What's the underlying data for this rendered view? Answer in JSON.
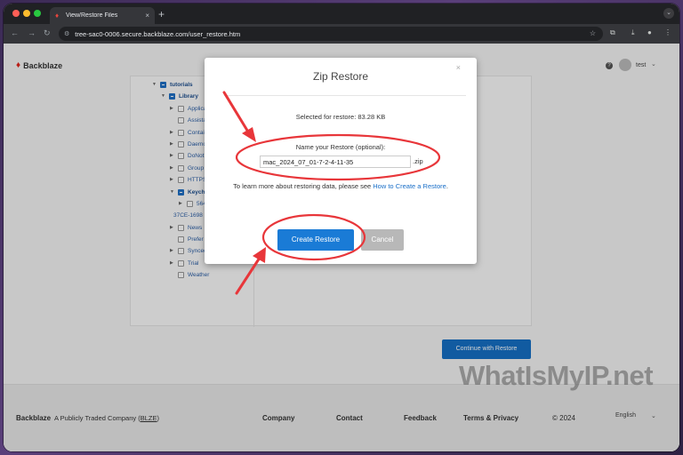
{
  "browser": {
    "tab_title": "View/Restore Files",
    "url": "tree-sac0-0006.secure.backblaze.com/user_restore.htm",
    "new_tab": "+",
    "tab_close": "×"
  },
  "header": {
    "brand": "Backblaze",
    "help": "?",
    "user_name": "test"
  },
  "tree": {
    "rows": [
      {
        "label": "tutorials",
        "arrow": "▼",
        "checked": true,
        "indent": 0
      },
      {
        "label": "Library",
        "arrow": "▼",
        "checked": true,
        "indent": 1
      },
      {
        "label": "Applica",
        "arrow": "▶",
        "checked": false,
        "indent": 2
      },
      {
        "label": "Assista",
        "arrow": "",
        "checked": false,
        "indent": 2
      },
      {
        "label": "Contai",
        "arrow": "▶",
        "checked": false,
        "indent": 2
      },
      {
        "label": "Daemo",
        "arrow": "▶",
        "checked": false,
        "indent": 2
      },
      {
        "label": "DoNot",
        "arrow": "▶",
        "checked": false,
        "indent": 2
      },
      {
        "label": "Group",
        "arrow": "▶",
        "checked": false,
        "indent": 2
      },
      {
        "label": "HTTPS",
        "arrow": "▶",
        "checked": false,
        "indent": 2
      },
      {
        "label": "Keych",
        "arrow": "▼",
        "checked": true,
        "indent": 2
      },
      {
        "label": "564",
        "arrow": "▶",
        "checked": false,
        "indent": 3
      },
      {
        "label": "37CE-1698",
        "arrow": "",
        "checked": null,
        "indent": 2
      },
      {
        "label": "News",
        "arrow": "▶",
        "checked": false,
        "indent": 2
      },
      {
        "label": "Prefer",
        "arrow": "",
        "checked": false,
        "indent": 2
      },
      {
        "label": "Synced",
        "arrow": "▶",
        "checked": false,
        "indent": 2
      },
      {
        "label": "Trial",
        "arrow": "▶",
        "checked": false,
        "indent": 2
      },
      {
        "label": "Weather",
        "arrow": "",
        "checked": false,
        "indent": 2
      }
    ]
  },
  "main": {
    "continue_label": "Continue with Restore"
  },
  "modal": {
    "title": "Zip Restore",
    "close": "×",
    "selected_text": "Selected for restore: 83.28 KB",
    "name_label": "Name your Restore (optional):",
    "name_value": "mac_2024_07_01-7-2-4-11-35",
    "zip_suffix": ".zip",
    "learn_prefix": "To learn more about restoring data, please see ",
    "learn_link": "How to Create a Restore",
    "learn_suffix": ".",
    "create_label": "Create Restore",
    "cancel_label": "Cancel"
  },
  "footer": {
    "brand": "Backblaze",
    "tagline_prefix": "A Publicly Traded Company (",
    "ticker": "BLZE",
    "tagline_suffix": ")",
    "company": "Company",
    "contact": "Contact",
    "feedback": "Feedback",
    "terms": "Terms & Privacy",
    "copyright": "© 2024",
    "language": "English"
  },
  "watermark": "WhatIsMyIP.net",
  "colors": {
    "accent": "#1a7bd6",
    "annotation": "#e8363a"
  }
}
